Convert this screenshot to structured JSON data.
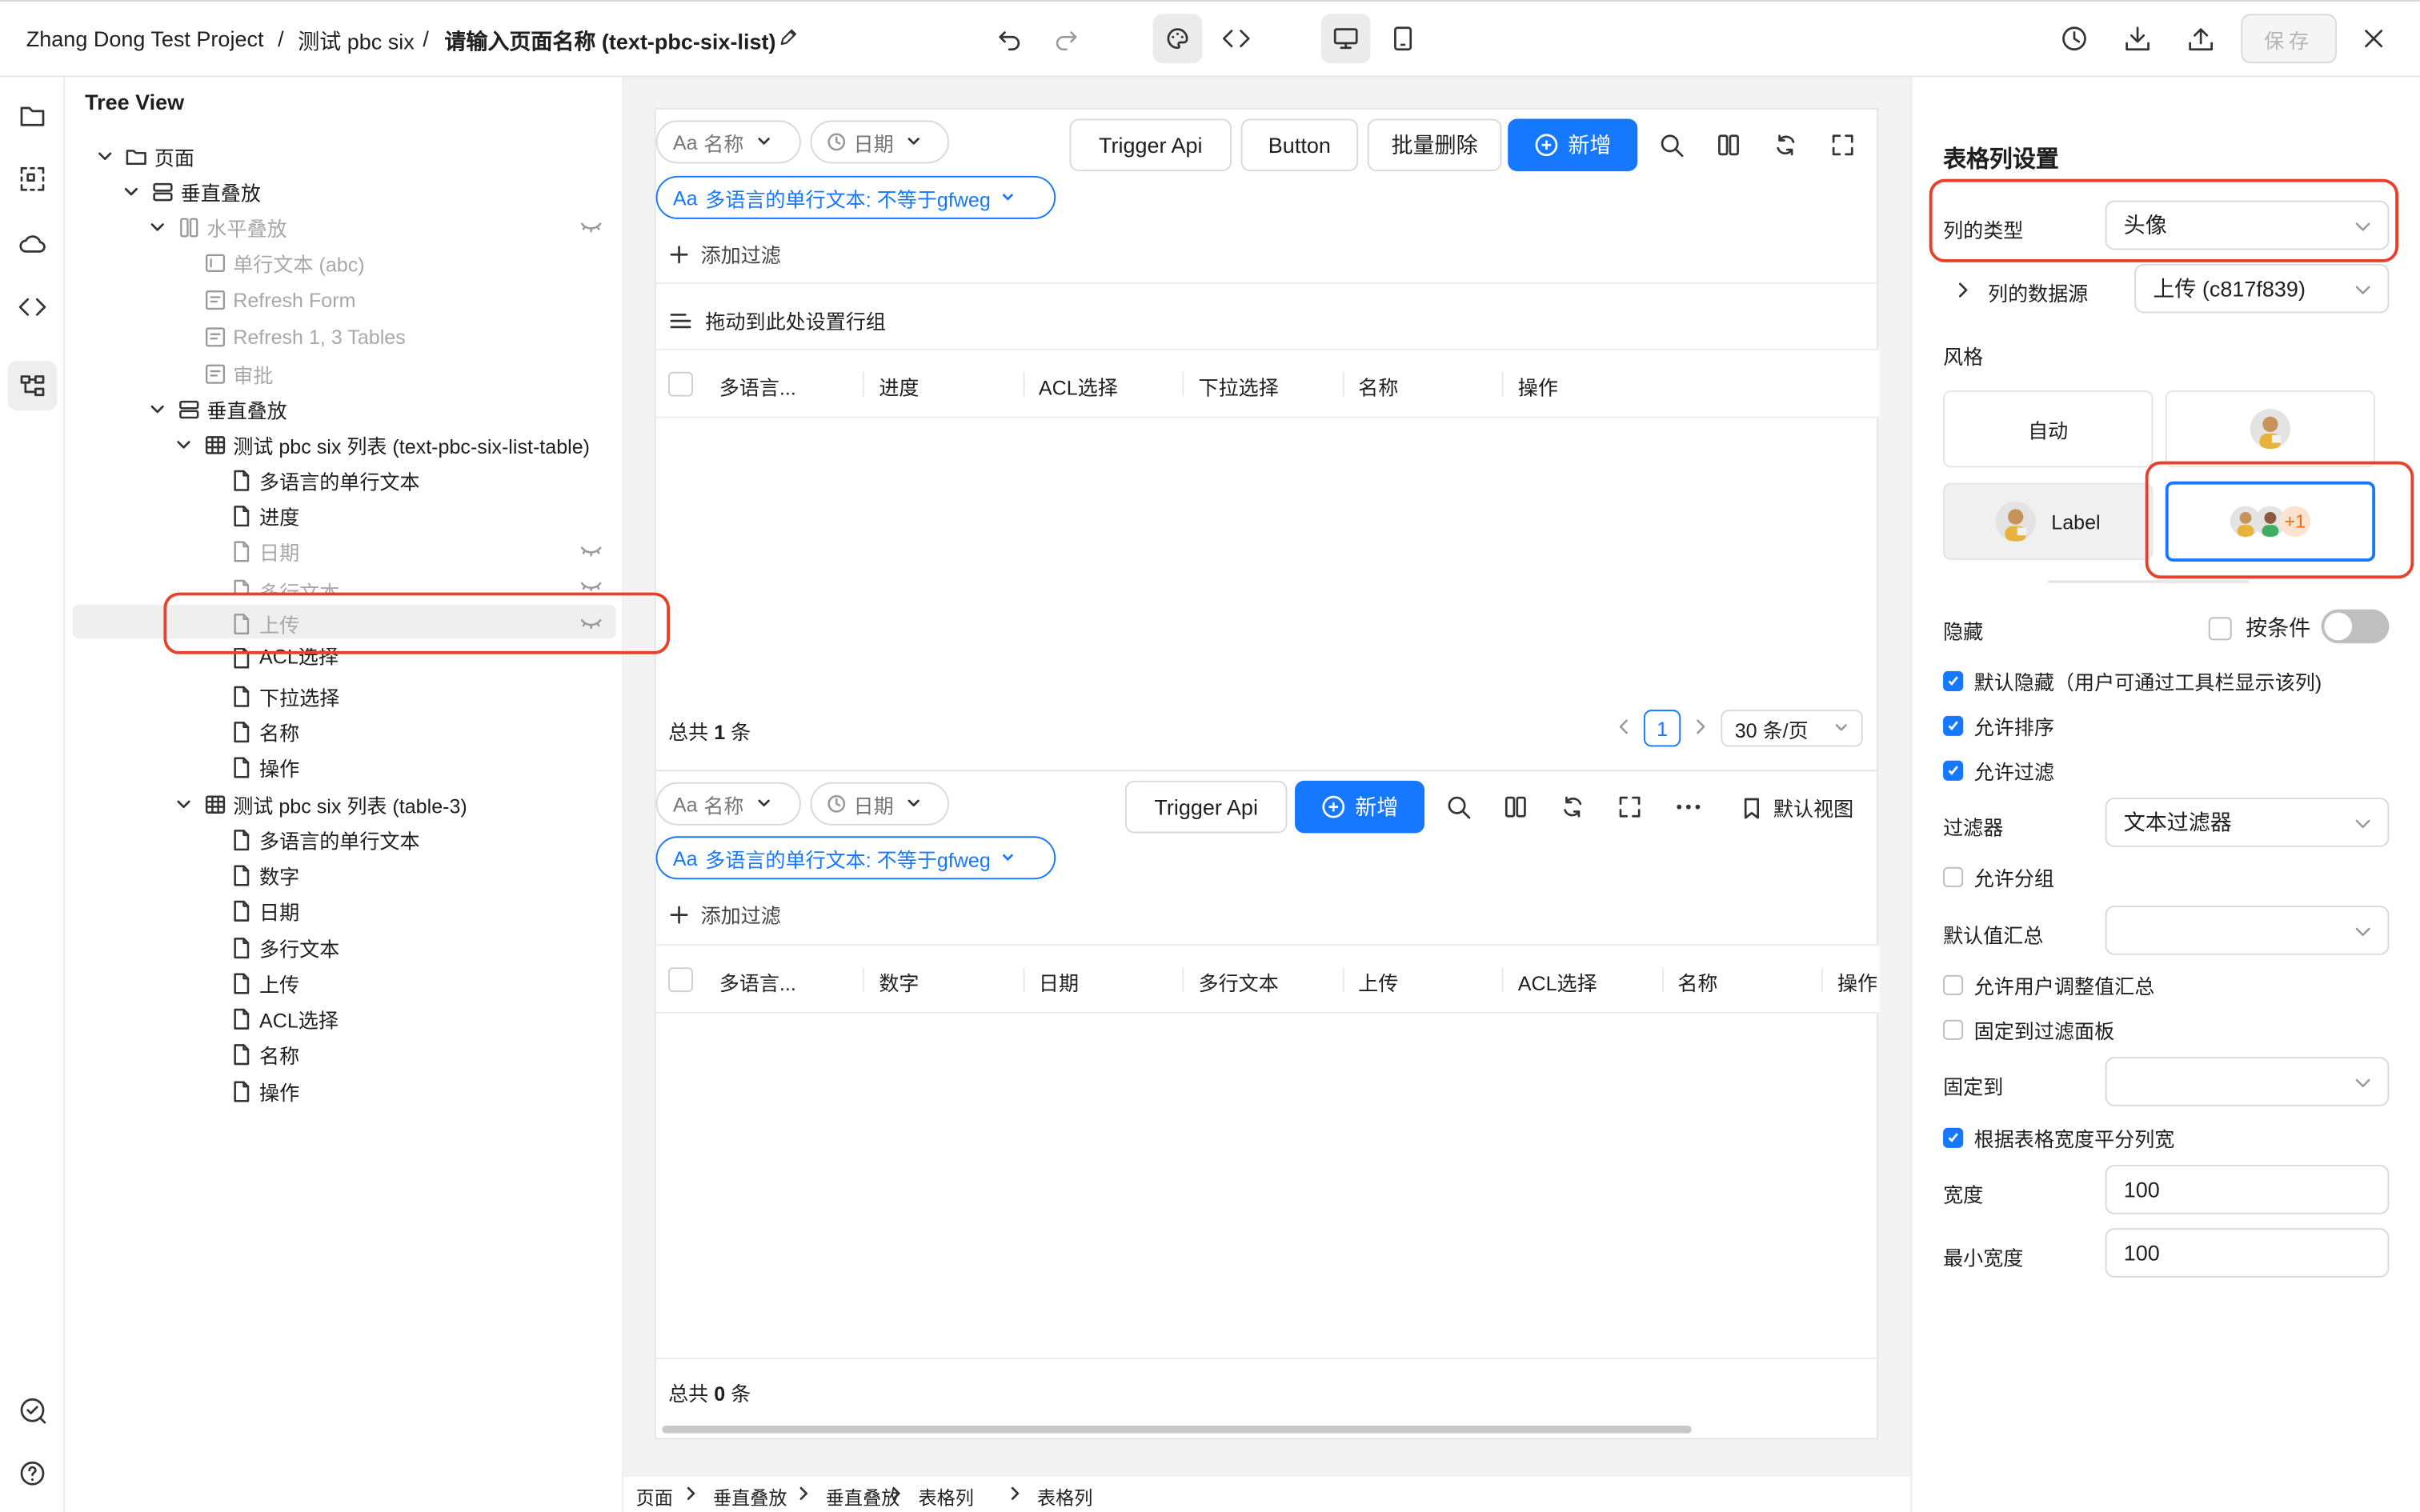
{
  "breadcrumb": {
    "project": "Zhang Dong Test Project",
    "app": "测试 pbc six",
    "page": "请输入页面名称 (text-pbc-six-list)",
    "sep": "/"
  },
  "toolbar": {
    "save_label": "保存"
  },
  "tree": {
    "title": "Tree View",
    "nodes": [
      {
        "label": "页面"
      },
      {
        "label": "垂直叠放"
      },
      {
        "label": "水平叠放"
      },
      {
        "label": "单行文本 (abc)"
      },
      {
        "label": "Refresh Form"
      },
      {
        "label": "Refresh 1, 3 Tables"
      },
      {
        "label": "审批"
      },
      {
        "label": "垂直叠放"
      },
      {
        "label": "测试 pbc six 列表 (text-pbc-six-list-table)"
      },
      {
        "label": "多语言的单行文本"
      },
      {
        "label": "进度"
      },
      {
        "label": "日期"
      },
      {
        "label": "多行文本"
      },
      {
        "label": "上传"
      },
      {
        "label": "ACL选择"
      },
      {
        "label": "下拉选择"
      },
      {
        "label": "名称"
      },
      {
        "label": "操作"
      },
      {
        "label": "测试 pbc six 列表 (table-3)"
      },
      {
        "label": "多语言的单行文本"
      },
      {
        "label": "数字"
      },
      {
        "label": "日期"
      },
      {
        "label": "多行文本"
      },
      {
        "label": "上传"
      },
      {
        "label": "ACL选择"
      },
      {
        "label": "名称"
      },
      {
        "label": "操作"
      }
    ]
  },
  "table1": {
    "filter_name": "名称",
    "filter_date": "日期",
    "aa": "Aa",
    "btn_trigger": "Trigger Api",
    "btn_button": "Button",
    "btn_batch_delete": "批量删除",
    "btn_add": "新增",
    "active_filter": "多语言的单行文本: 不等于gfweg",
    "add_filter": "添加过滤",
    "group_hint": "拖动到此处设置行组",
    "columns": [
      "多语言...",
      "进度",
      "ACL选择",
      "下拉选择",
      "名称",
      "操作"
    ],
    "total_prefix": "总共",
    "total_count": "1",
    "total_suffix": "条",
    "page": "1",
    "page_size": "30 条/页"
  },
  "table2": {
    "filter_name": "名称",
    "filter_date": "日期",
    "aa": "Aa",
    "btn_trigger": "Trigger Api",
    "btn_add": "新增",
    "default_view": "默认视图",
    "active_filter": "多语言的单行文本: 不等于gfweg",
    "add_filter": "添加过滤",
    "columns": [
      "多语言...",
      "数字",
      "日期",
      "多行文本",
      "上传",
      "ACL选择",
      "名称",
      "操作"
    ],
    "total_prefix": "总共",
    "total_count": "0",
    "total_suffix": "条"
  },
  "bottom_breadcrumb": [
    "页面",
    "垂直叠放",
    "垂直叠放",
    "表格列",
    "表格列"
  ],
  "panel": {
    "title": "表格列设置",
    "column_type_label": "列的类型",
    "column_type_value": "头像",
    "datasource_label": "列的数据源",
    "datasource_value": "上传 (c817f839)",
    "style_label": "风格",
    "style_auto": "自动",
    "style_label_opt": "Label",
    "style_more": "+1",
    "hidden_label": "隐藏",
    "by_condition": "按条件",
    "default_hidden": "默认隐藏（用户可通过工具栏显示该列)",
    "allow_sort": "允许排序",
    "allow_filter": "允许过滤",
    "filter_label": "过滤器",
    "filter_value": "文本过滤器",
    "allow_group": "允许分组",
    "default_agg_label": "默认值汇总",
    "default_agg_value": "",
    "allow_user_agg": "允许用户调整值汇总",
    "pin_filter_panel": "固定到过滤面板",
    "pin_to_label": "固定到",
    "pin_to_value": "",
    "equal_width": "根据表格宽度平分列宽",
    "width_label": "宽度",
    "width_value": "100",
    "min_width_label": "最小宽度",
    "min_width_value": "100"
  },
  "colors": {
    "accent": "#1677ff",
    "highlight": "#e8412b"
  }
}
